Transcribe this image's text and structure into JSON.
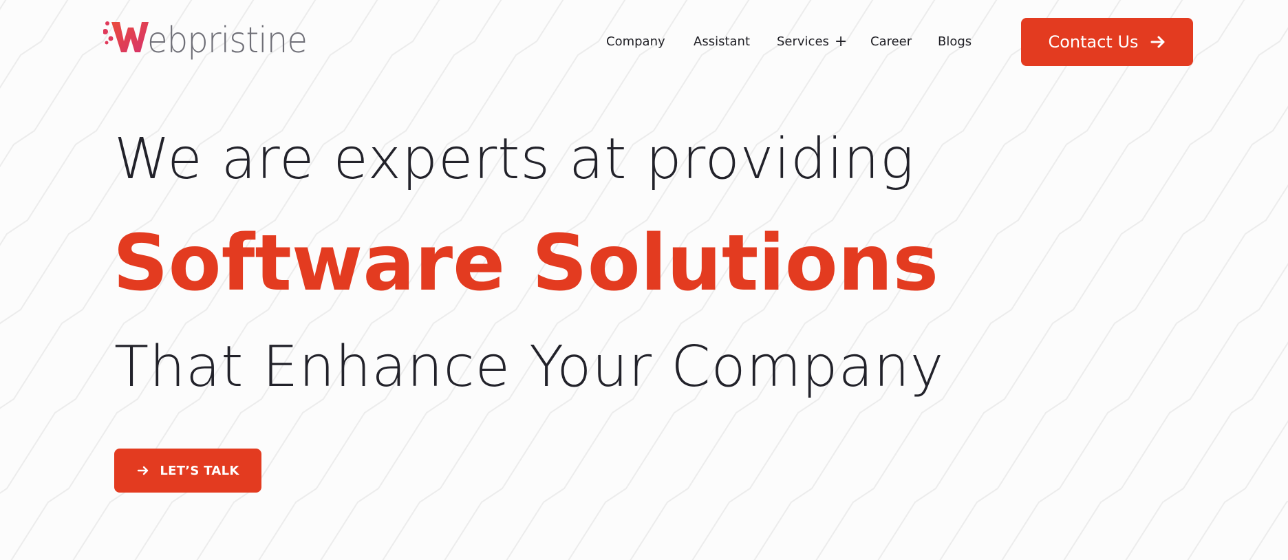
{
  "brand": {
    "logo_text": "Webpristine",
    "logo_accent_color": "#e0395a",
    "logo_text_color": "#6e6e76"
  },
  "nav": {
    "items": [
      {
        "label": "Company"
      },
      {
        "label": "Assistant"
      },
      {
        "label": "Services",
        "has_submenu": true,
        "submenu_icon": "plus-icon"
      },
      {
        "label": "Career"
      },
      {
        "label": "Blogs"
      }
    ],
    "submenu_glyph": "+"
  },
  "header": {
    "contact_button_label": "Contact Us",
    "contact_button_icon": "arrow-right-icon"
  },
  "hero": {
    "line1": "We are experts at providing",
    "line2": "Software Solutions",
    "line3": "That Enhance Your Company",
    "cta_label": "LET’S TALK",
    "cta_icon": "arrow-right-icon"
  },
  "colors": {
    "accent": "#e33b20",
    "text_dark": "#22222a",
    "background": "#fcfcfc"
  }
}
